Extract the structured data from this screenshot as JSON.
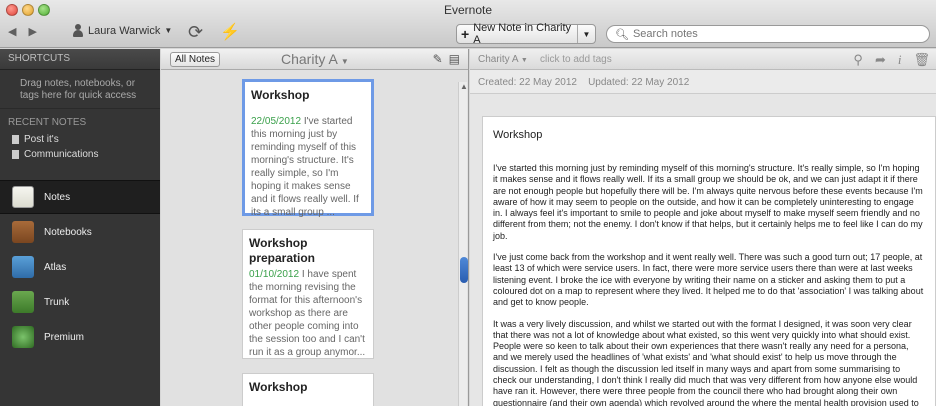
{
  "window": {
    "title": "Evernote"
  },
  "toolbar": {
    "user_name": "Laura Warwick",
    "new_note_label": "New Note in Charity A",
    "search_placeholder": "Search notes"
  },
  "sidebar": {
    "shortcuts_header": "SHORTCUTS",
    "shortcuts_hint": "Drag notes, notebooks, or tags here for quick access",
    "recent_header": "RECENT NOTES",
    "recent_notes": [
      "Post it's",
      "Communications"
    ],
    "nav": [
      {
        "label": "Notes",
        "icon": "notes-icon",
        "active": true
      },
      {
        "label": "Notebooks",
        "icon": "notebook-icon",
        "active": false
      },
      {
        "label": "Atlas",
        "icon": "map-icon",
        "active": false
      },
      {
        "label": "Trunk",
        "icon": "trunk-icon",
        "active": false
      },
      {
        "label": "Premium",
        "icon": "premium-icon",
        "active": false
      }
    ]
  },
  "note_list": {
    "all_notes_label": "All Notes",
    "notebook_title": "Charity A",
    "cards": [
      {
        "title": "Workshop",
        "date": "22/05/2012",
        "snippet": "I've started this morning just by reminding myself of this morning's structure. It's really simple, so I'm hoping it makes sense and it flows really well. If its a small group ..."
      },
      {
        "title": "Workshop preparation",
        "date": "01/10/2012",
        "snippet": "I have spent the morning revising the format for this afternoon's workshop as there are other people coming into the session too and I can't run it as a group anymor..."
      },
      {
        "title": "Workshop",
        "date": "",
        "snippet": ""
      }
    ]
  },
  "editor": {
    "notebook": "Charity A",
    "tags_placeholder": "click to add tags",
    "created": "Created: 22 May 2012",
    "updated": "Updated: 22 May 2012",
    "title": "Workshop",
    "paragraphs": [
      "I've started this morning just by reminding myself of this morning's structure. It's really simple, so I'm hoping it makes sense and it flows really well. If its a small group we should be ok, and we can just adapt it if there are not enough people but hopefully there will be. I'm always quite nervous before these events because I'm aware of how it may seem to people on the outside, and how it can be completely uninteresting to engage in. I always feel it's important to smile to people and joke about myself to make myself seem friendly and no different from them; not the enemy. I don't know if that helps, but it certainly helps me to feel like I can do my job.",
      "I've just come back from the workshop and it went really well. There was such a good turn out; 17 people, at least 13 of which were service users. In fact, there were more service users there than were at last weeks listening event. I broke the ice with everyone by writing their name on a sticker and asking them to put a coloured dot on a map to represent where they lived. It helped me to do that 'association' I was talking about and get to know people.",
      "It was a very lively discussion, and whilst we started out with the format I designed, it was soon very clear that there was not a lot of knowledge about what existed, so this went very quickly into what should exist. People were so keen to talk about their own experiences that there wasn't really any need for a persona, and we merely used the headlines of 'what exists' and 'what should exist' to help us move through the discussion. I felt as though the discussion led itself in many ways and apart from some summarising to check our understanding, I don't think I really did much that was very different from how anyone else would have ran it. However, there were three people from the council there who had brought along their own questionnaire (and their own agenda) which revolved around the                                where the mental health provision used to be focused."
    ]
  }
}
